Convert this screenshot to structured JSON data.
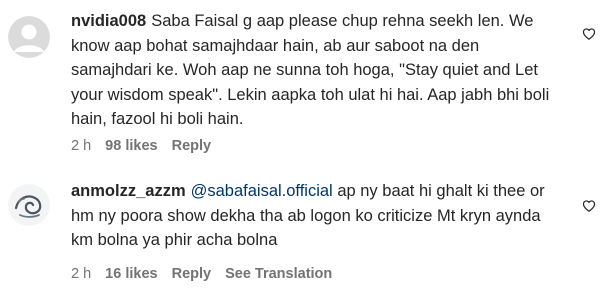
{
  "comments": [
    {
      "username": "nvidia008",
      "mention": "",
      "text": "Saba Faisal g aap please chup rehna seekh len. We know aap bohat samajhdaar hain, ab aur saboot na den samajhdari ke. Woh aap ne sunna toh hoga, \"Stay quiet and Let your wisdom speak\". Lekin aapka toh ulat hi hai. Aap jabh bhi boli hain, fazool hi boli hain.",
      "time": "2 h",
      "likes": "98 likes",
      "reply": "Reply",
      "translate": "",
      "avatar_icon": "default-avatar-icon",
      "like_icon": "heart-icon"
    },
    {
      "username": "anmolzz_azzm",
      "mention": "@sabafaisal.official",
      "text": " ap ny baat hi ghalt ki thee or hm ny poora show dekha tha ab logon ko criticize Mt kryn aynda km bolna ya phir acha bolna",
      "time": "2 h",
      "likes": "16 likes",
      "reply": "Reply",
      "translate": "See Translation",
      "avatar_icon": "sketch-avatar-icon",
      "like_icon": "heart-icon"
    }
  ],
  "colors": {
    "text": "#262626",
    "meta": "#737373",
    "mention": "#00376b"
  }
}
